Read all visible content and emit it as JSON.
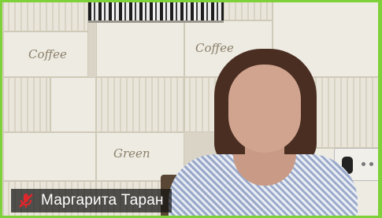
{
  "participant": {
    "name": "Маргарита Таран",
    "mic_status": "muted",
    "active_speaker": true,
    "highlight_color": "#7fd13a",
    "mic_icon_color": "#e0262b"
  },
  "background": {
    "tile_words": [
      "Coffee",
      "Coffee",
      "Green"
    ]
  }
}
